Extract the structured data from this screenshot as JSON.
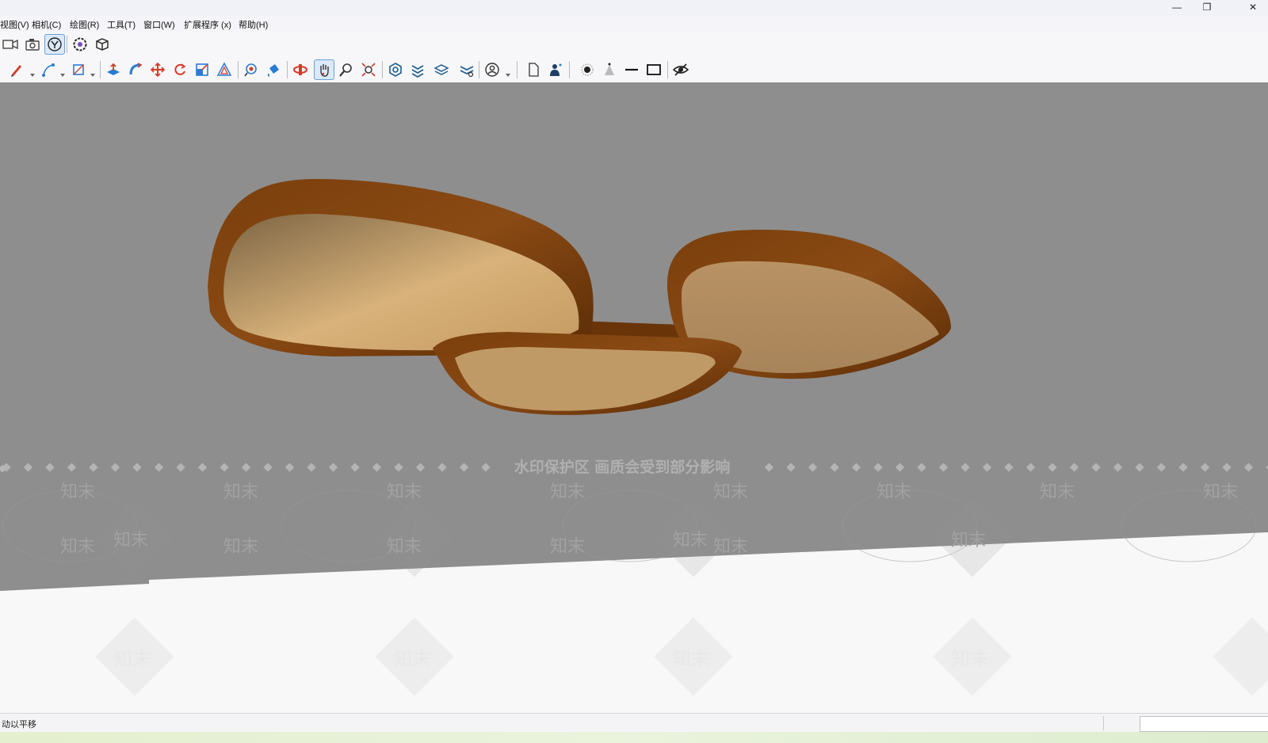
{
  "window": {
    "minimize_glyph": "—",
    "restore_glyph": "❐",
    "close_glyph": "✕"
  },
  "menu": [
    "视图(V)",
    "相机(C)",
    "绘图(R)",
    "工具(T)",
    "窗口(W)",
    "扩展程序 (x)",
    "帮助(H)"
  ],
  "watermark": {
    "banner": "水印保护区    画质会受到部分影响",
    "brand": "知末"
  },
  "status": {
    "hint": "动以平移",
    "measurements_value": ""
  },
  "colors": {
    "viewport_bg": "#8e8e8e",
    "wood_frame": "#6b3608",
    "panel_inner": "#c4a06b",
    "active_tool": "#6aa0d8"
  },
  "icons": {
    "toolbar1": [
      "camera-video-icon",
      "camera-snapshot-icon",
      "look-around-icon",
      "gear-flower-icon",
      "box-export-icon"
    ],
    "toolbar2": [
      "pencil-icon",
      "line-tool-icon",
      "rectangle-tool-icon",
      "push-pull-icon",
      "follow-me-icon",
      "move-icon",
      "rotate-icon",
      "scale-icon",
      "offset-icon",
      "tape-measure-icon",
      "paint-bucket-icon",
      "orbit-icon",
      "pan-hand-icon",
      "zoom-icon",
      "zoom-extents-icon",
      "solid-tools-icon",
      "sandbox-icon",
      "layers-icon",
      "layers-settings-icon",
      "user-circle-icon",
      "page-icon",
      "person-icon",
      "shadow-dot-icon",
      "cone-icon",
      "line-style-icon",
      "rectangle-style-icon",
      "hide-icon"
    ]
  }
}
